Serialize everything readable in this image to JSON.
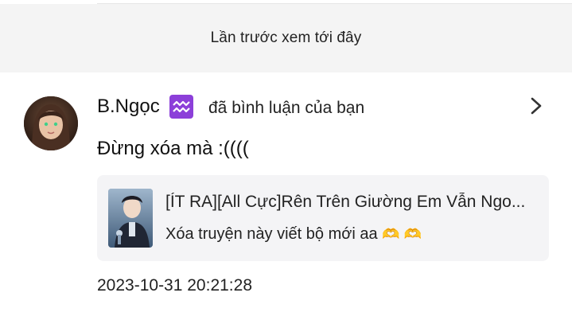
{
  "banner": {
    "text": "Lần trước xem tới đây"
  },
  "notification": {
    "username": "B.Ngọc",
    "zodiac_symbol": "♒",
    "action": "đã bình luận của bạn",
    "comment": "Đừng xóa mà :((((",
    "timestamp": "2023-10-31 20:21:28"
  },
  "story": {
    "title": "[ÍT RA][All Cực]Rên Trên Giường Em Vẫn Ngo...",
    "excerpt": "Xóa truyện này viết bộ mới aa",
    "emoji": "🫶 🫶"
  },
  "icons": {
    "avatar": "user-avatar",
    "badge": "aquarius-icon",
    "chevron": "chevron-right-icon",
    "thumb": "story-cover-image"
  },
  "colors": {
    "banner_bg": "#f4f4f4",
    "card_bg": "#f4f4f6",
    "badge": "#8c3fd9"
  }
}
